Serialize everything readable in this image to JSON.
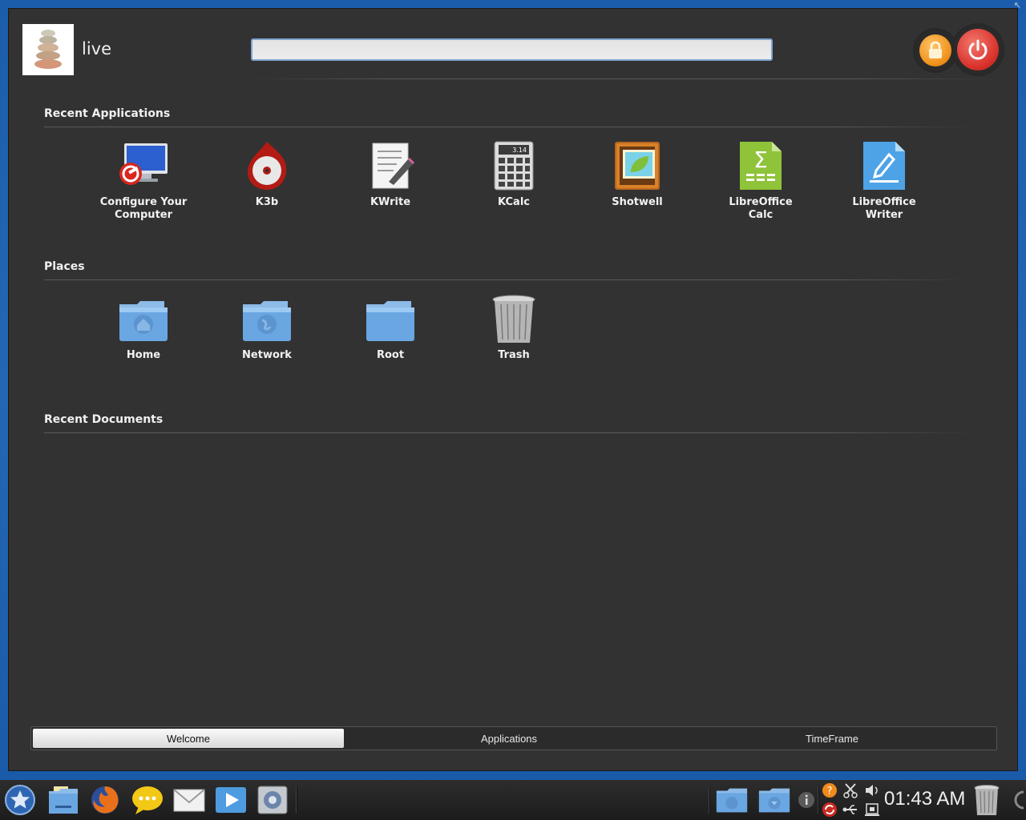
{
  "user": {
    "name": "live"
  },
  "search": {
    "value": "",
    "placeholder": ""
  },
  "sections": {
    "recent_applications": "Recent Applications",
    "places": "Places",
    "recent_documents": "Recent Documents"
  },
  "recent_applications": [
    {
      "label": "Configure Your Computer",
      "icon": "system-settings-icon"
    },
    {
      "label": "K3b",
      "icon": "k3b-disc-burner-icon"
    },
    {
      "label": "KWrite",
      "icon": "kwrite-text-editor-icon"
    },
    {
      "label": "KCalc",
      "icon": "calculator-icon",
      "display": "3.14"
    },
    {
      "label": "Shotwell",
      "icon": "shotwell-photo-icon"
    },
    {
      "label": "LibreOffice Calc",
      "icon": "libreoffice-calc-icon"
    },
    {
      "label": "LibreOffice Writer",
      "icon": "libreoffice-writer-icon"
    }
  ],
  "places": [
    {
      "label": "Home",
      "icon": "home-folder-icon"
    },
    {
      "label": "Network",
      "icon": "network-folder-icon"
    },
    {
      "label": "Root",
      "icon": "folder-icon"
    },
    {
      "label": "Trash",
      "icon": "trash-icon"
    }
  ],
  "tabs": [
    {
      "label": "Welcome",
      "active": true
    },
    {
      "label": "Applications",
      "active": false
    },
    {
      "label": "TimeFrame",
      "active": false
    }
  ],
  "taskbar": {
    "clock": "01:43 AM",
    "launchers": [
      "start-menu-icon",
      "file-manager-icon",
      "firefox-icon",
      "chat-icon",
      "mail-icon",
      "media-player-icon",
      "system-tool-icon"
    ],
    "tray": [
      "folder-documents-icon",
      "folder-downloads-icon",
      "info-icon",
      "help-icon",
      "update-icon",
      "scissors-icon",
      "usb-icon",
      "volume-icon",
      "network-icon",
      "trash-icon"
    ]
  },
  "colors": {
    "panel": "#323232",
    "desktop": "#1b5dab",
    "lock": "#f0921c",
    "power": "#d8322b"
  }
}
